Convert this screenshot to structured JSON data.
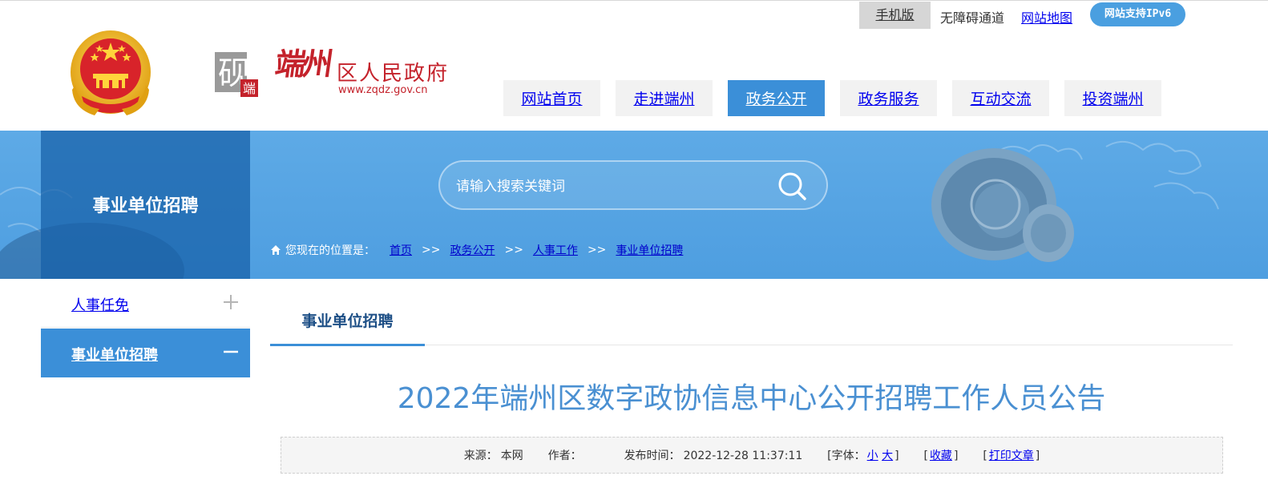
{
  "top_bar": {
    "mobile": "手机版",
    "accessibility": "无障碍通道",
    "sitemap": "网站地图",
    "ipv6": "网站支持IPv6"
  },
  "header": {
    "emblem": "national-emblem-icon",
    "logo": {
      "brush": "端州",
      "title": "区人民政府",
      "url": "www.zqdz.gov.cn"
    }
  },
  "nav": {
    "items": [
      {
        "label": "网站首页",
        "active": false
      },
      {
        "label": "走进端州",
        "active": false
      },
      {
        "label": "政务公开",
        "active": true
      },
      {
        "label": "政务服务",
        "active": false
      },
      {
        "label": "互动交流",
        "active": false
      },
      {
        "label": "投资端州",
        "active": false
      }
    ]
  },
  "banner": {
    "section_title": "事业单位招聘",
    "search": {
      "placeholder": "请输入搜索关键词"
    }
  },
  "breadcrumb": {
    "prefix": "您现在的位置是：",
    "items": [
      "首页",
      "政务公开",
      "人事工作",
      "事业单位招聘"
    ],
    "separator": ">>"
  },
  "sidebar": {
    "items": [
      {
        "label": "人事任免",
        "toggle": "+",
        "active": false
      },
      {
        "label": "事业单位招聘",
        "toggle": "−",
        "active": true
      }
    ]
  },
  "content": {
    "tab": "事业单位招聘",
    "title": "2022年端州区数字政协信息中心公开招聘工作人员公告",
    "meta": {
      "source_label": "来源：",
      "source": "本网",
      "author_label": "作者：",
      "author": "",
      "published_label": "发布时间：",
      "published": "2022-12-28 11:37:11",
      "font_label": "[字体：",
      "font_small": "小",
      "font_large": "大",
      "font_close": "]",
      "favorite": "收藏",
      "print": "打印文章"
    }
  },
  "colors": {
    "accent": "#3b8fd8",
    "banner": "#4e9ee0",
    "title": "#4a90d2",
    "logo_red": "#c4222b"
  }
}
